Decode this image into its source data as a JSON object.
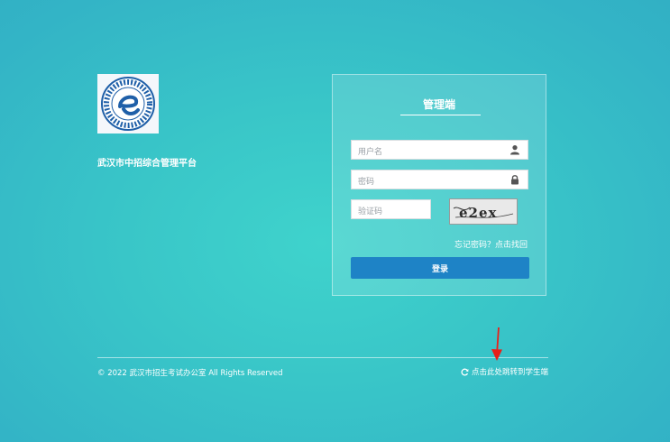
{
  "platform": {
    "title": "武汉市中招综合管理平台",
    "logo_icon": "letter-e-seal-logo"
  },
  "login": {
    "heading": "管理端",
    "username_placeholder": "用户名",
    "password_placeholder": "密码",
    "captcha_placeholder": "验证码",
    "captcha_text": "e2ex",
    "forgot_link": "忘记密码？点击找回",
    "submit_label": "登录",
    "icons": {
      "username": "user-icon",
      "password": "lock-icon"
    }
  },
  "footer": {
    "copyright": "© 2022 武汉市招生考试办公室 All Rights Reserved",
    "switch_link": "点击此处跳转到学生端",
    "switch_icon": "refresh-icon"
  },
  "colors": {
    "background": "#39c6c8",
    "button": "#1e83c6",
    "annotation_arrow": "#e8201a"
  }
}
